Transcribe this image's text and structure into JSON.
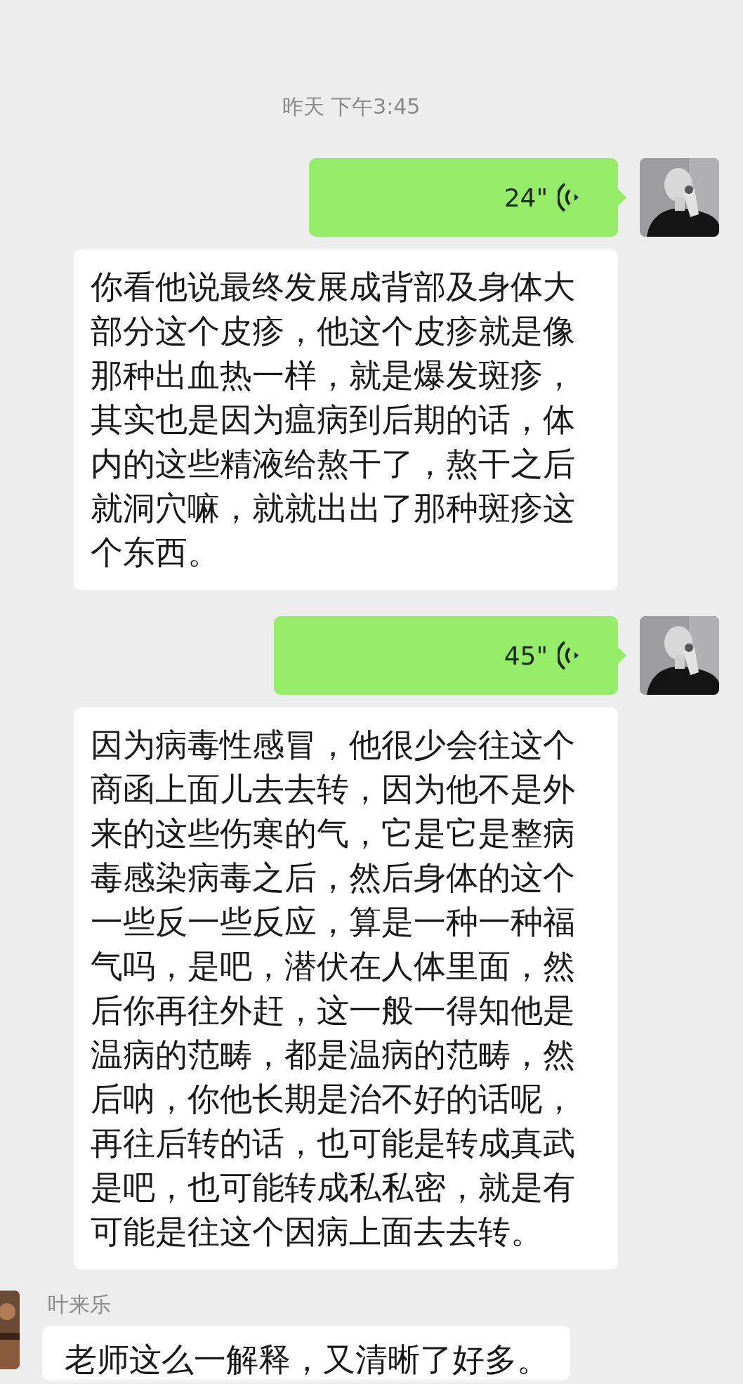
{
  "messages": [
    {
      "kind": "time",
      "text": "昨天 下午3:45"
    },
    {
      "kind": "voice",
      "duration": "24\"",
      "transcript": "你看他说最终发展成背部及身体大部分这个皮疹，他这个皮疹就是像那种出血热一样，就是爆发斑疹，其实也是因为瘟病到后期的话，体内的这些精液给熬干了，熬干之后就洞穴嘛，就就出出了那种斑疹这个东西。"
    },
    {
      "kind": "voice",
      "duration": "45\"",
      "transcript": "因为病毒性感冒，他很少会往这个商函上面儿去去转，因为他不是外来的这些伤寒的气，它是它是整病毒感染病毒之后，然后身体的这个一些反一些反应，算是一种一种福气吗，是吧，潜伏在人体里面，然后你再往外赶，这一般一得知他是温病的范畴，都是温病的范畴，然后呐，你他长期是治不好的话呢，再往后转的话，也可能是转成真武是吧，也可能转成私私密，就是有可能是往这个因病上面去去转。"
    },
    {
      "kind": "text",
      "sender": "叶来乐",
      "text": "老师这么一解释，又清晰了好多。"
    }
  ]
}
